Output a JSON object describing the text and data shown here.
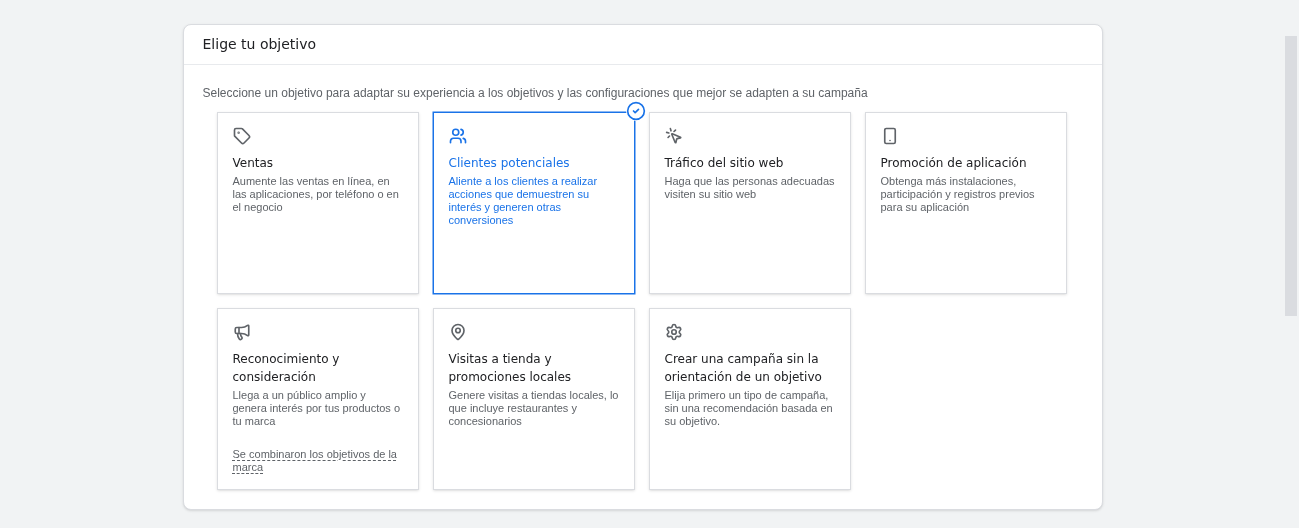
{
  "card": {
    "title": "Elige tu objetivo",
    "subtitle": "Seleccione un objetivo para adaptar su experiencia a los objetivos y las configuraciones que mejor se adapten a su campaña"
  },
  "objectives": [
    {
      "title": "Ventas",
      "description": "Aumente las ventas en línea, en las aplicaciones, por teléfono o en el negocio",
      "selected": false
    },
    {
      "title": "Clientes potenciales",
      "description": "Aliente a los clientes a realizar acciones que demuestren su interés y generen otras conversiones",
      "selected": true
    },
    {
      "title": "Tráfico del sitio web",
      "description": "Haga que las personas adecuadas visiten su sitio web",
      "selected": false
    },
    {
      "title": "Promoción de aplicación",
      "description": "Obtenga más instalaciones, participación y registros previos para su aplicación",
      "selected": false
    },
    {
      "title": "Reconocimiento y consideración",
      "description": "Llega a un público amplio y genera interés por tus productos o tu marca",
      "link": "Se combinaron los objetivos de la marca",
      "selected": false
    },
    {
      "title": "Visitas a tienda y promociones locales",
      "description": "Genere visitas a tiendas locales, lo que incluye restaurantes y concesionarios",
      "selected": false
    },
    {
      "title": "Crear una campaña sin la orientación de un objetivo",
      "description": "Elija primero un tipo de campaña, sin una recomendación basada en su objetivo.",
      "selected": false
    }
  ]
}
